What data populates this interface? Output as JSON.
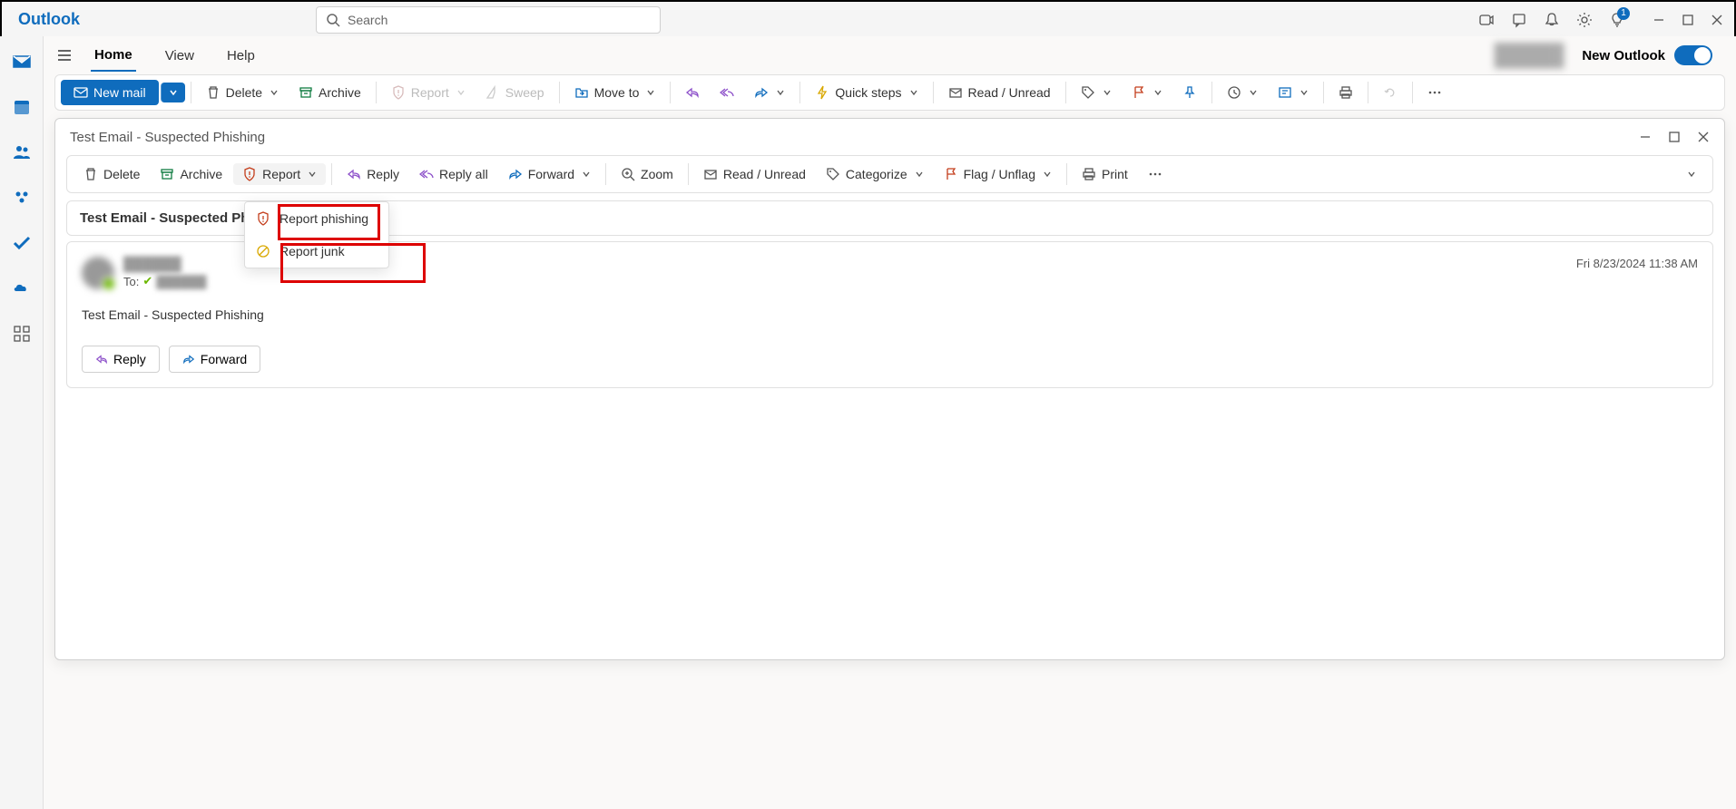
{
  "titlebar": {
    "logo": "Outlook",
    "search_placeholder": "Search",
    "notification_badge": "1"
  },
  "tabs": {
    "home": "Home",
    "view": "View",
    "help": "Help",
    "new_outlook": "New Outlook"
  },
  "toolbar": {
    "new_mail": "New mail",
    "delete": "Delete",
    "archive": "Archive",
    "report": "Report",
    "sweep": "Sweep",
    "move_to": "Move to",
    "quick_steps": "Quick steps",
    "read_unread": "Read / Unread"
  },
  "message_window": {
    "title": "Test Email - Suspected Phishing"
  },
  "msg_toolbar": {
    "delete": "Delete",
    "archive": "Archive",
    "report": "Report",
    "reply": "Reply",
    "reply_all": "Reply all",
    "forward": "Forward",
    "zoom": "Zoom",
    "read_unread": "Read / Unread",
    "categorize": "Categorize",
    "flag": "Flag / Unflag",
    "print": "Print"
  },
  "dropdown": {
    "report_phishing": "Report phishing",
    "report_junk": "Report junk"
  },
  "subject": "Test Email - Suspected Phi:",
  "message": {
    "to_label": "To:",
    "date": "Fri 8/23/2024 11:38 AM",
    "body": "Test Email - Suspected Phishing",
    "reply": "Reply",
    "forward": "Forward"
  },
  "right_date": "024 11:38 AM"
}
